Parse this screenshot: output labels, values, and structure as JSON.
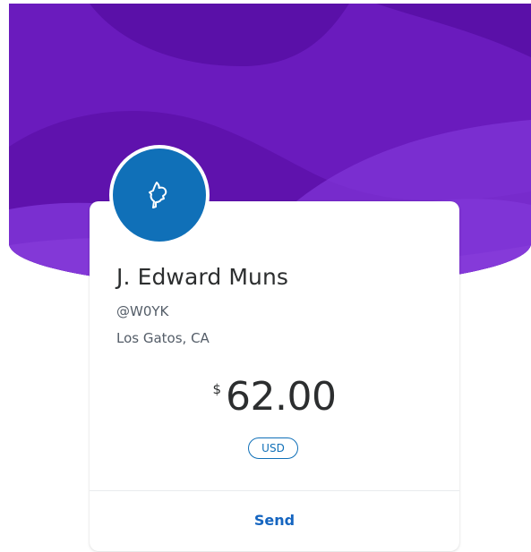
{
  "profile": {
    "name": "J. Edward Muns",
    "handle": "@W0YK",
    "location": "Los Gatos, CA"
  },
  "payment": {
    "currency_symbol": "$",
    "amount": "62.00",
    "currency_code": "USD"
  },
  "actions": {
    "send_label": "Send"
  },
  "colors": {
    "hero_purple": "#6a1bbd",
    "avatar_blue": "#1070b8",
    "link_blue": "#1565c0"
  },
  "icons": {
    "avatar": "profile-silhouette-icon"
  }
}
